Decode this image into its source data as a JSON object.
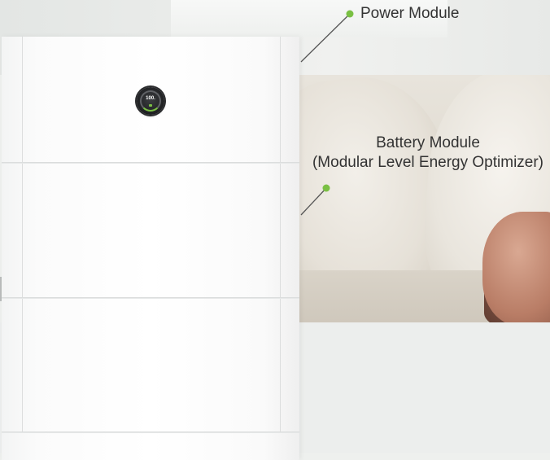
{
  "callouts": {
    "power_module": "Power Module",
    "battery_module_line1": "Battery Module",
    "battery_module_line2": "(Modular Level Energy Optimizer)"
  },
  "display": {
    "reading": "100."
  },
  "colors": {
    "accent_green": "#7ac043",
    "label_text": "#333333",
    "leader_line": "#555555"
  }
}
